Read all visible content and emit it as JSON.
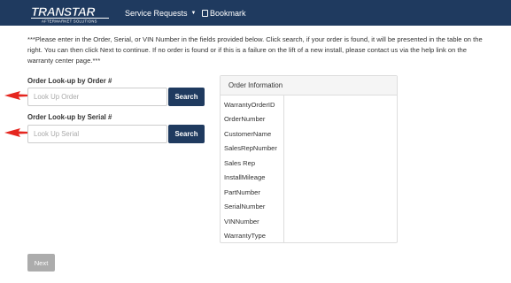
{
  "navbar": {
    "logo_text": "TRANSTAR",
    "logo_subtext": "AFTERMARKET SOLUTIONS",
    "service_requests_label": "Service Requests",
    "bookmark_label": "Bookmark",
    "background_color": "#1f3a5f"
  },
  "instructions": "***Please enter in the Order, Serial, or VIN Number in the fields provided below. Click search, if your order is found, it will be presented in the table on the right. You can then click Next to continue. If no order is found or if this is a failure on the lift of a new install, please contact us via the help link on the warranty center page.***",
  "order_lookup": {
    "label": "Order Look-up by Order #",
    "placeholder": "Look Up Order",
    "value": "",
    "button_label": "Search"
  },
  "serial_lookup": {
    "label": "Order Look-up by Serial #",
    "placeholder": "Look Up Serial",
    "value": "",
    "button_label": "Search"
  },
  "order_information": {
    "heading": "Order Information",
    "fields": [
      "WarrantyOrderID",
      "OrderNumber",
      "CustomerName",
      "SalesRepNumber",
      "Sales Rep",
      "InstallMileage",
      "PartNumber",
      "SerialNumber",
      "VINNumber",
      "WarrantyType"
    ]
  },
  "next_button_label": "Next",
  "accent_color": "#1f3a5f",
  "annotation_arrow_color": "#e5261f"
}
